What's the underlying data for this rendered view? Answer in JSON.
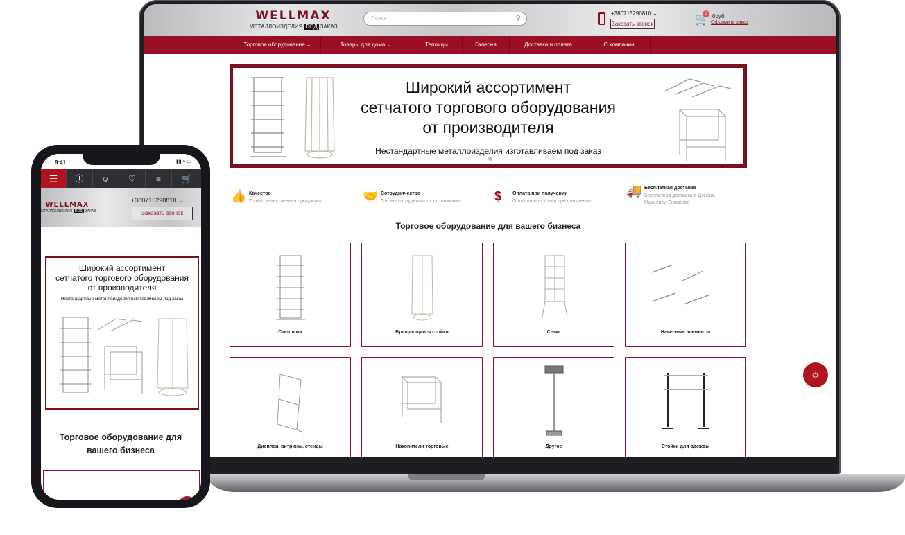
{
  "laptop": {
    "logo": {
      "main": "WELLMAX",
      "sub_left": "МЕТАЛЛОИЗДЕЛИЯ",
      "sub_box": "ПОД",
      "sub_right": "ЗАКАЗ"
    },
    "search": {
      "placeholder": "Поиск"
    },
    "header": {
      "phone": "+380715290810",
      "call_button": "Заказать звонок",
      "cart_count": "0",
      "cart_sum": "0руб.",
      "cart_order": "Оформить заказ"
    },
    "nav": [
      {
        "label": "Торговое оборудование",
        "has_caret": true
      },
      {
        "label": "Товары для дома",
        "has_caret": true
      },
      {
        "label": "Теплицы"
      },
      {
        "label": "Галерея"
      },
      {
        "label": "Доставка и оплата"
      },
      {
        "label": "О компании"
      }
    ],
    "banner": {
      "title_line1": "Широкий ассортимент",
      "title_line2": "сетчатого торгового оборудования",
      "title_line3": "от производителя",
      "subtitle": "Нестандартные металлоизделия изготавливаем под заказ"
    },
    "features": [
      {
        "icon": "thumbs-up-icon",
        "title": "Качество",
        "desc": "Только качественная продукция"
      },
      {
        "icon": "handshake-icon",
        "title": "Сотрудничество",
        "desc": "Готовы сотрудничать с оптовиками"
      },
      {
        "icon": "dollar-icon",
        "title": "Оплата при получении",
        "desc": "Оплачиваете товар при получении"
      },
      {
        "icon": "truck-icon",
        "title": "Бесплатная доставка",
        "desc": "Бесплатная доставка в Донецк, Макеевку, Енакиево"
      }
    ],
    "section_title": "Торговое оборудование для вашего бизнеса",
    "categories": [
      {
        "label": "Стеллажи",
        "icon": "shelf-rack-icon"
      },
      {
        "label": "Вращающиеся стойки",
        "icon": "rotating-stand-icon"
      },
      {
        "label": "Сетка",
        "icon": "mesh-panel-icon"
      },
      {
        "label": "Навесные элементы",
        "icon": "hooks-icon"
      },
      {
        "label": "Дисплеи, витрины, стенды",
        "icon": "display-stand-icon"
      },
      {
        "label": "Накопители торговые",
        "icon": "wire-basket-icon"
      },
      {
        "label": "Другое",
        "icon": "sign-holder-icon"
      },
      {
        "label": "Стойки для одежды",
        "icon": "clothes-rack-icon"
      }
    ],
    "colors": {
      "accent": "#9b0f25",
      "nav": "#9b0f25",
      "toolbar": "#2f2f33"
    }
  },
  "phone": {
    "time": "9:41",
    "header": {
      "phone": "+380715290810",
      "call_button": "Заказать звонок"
    },
    "banner": {
      "title_line1": "Широкий ассортимент",
      "title_line2": "сетчатого торгового оборудования",
      "title_line3": "от производителя",
      "subtitle": "Нестандартные металлоизделия изготавливаем под заказ"
    },
    "section_title_line1": "Торговое оборудование для",
    "section_title_line2": "вашего бизнеса"
  }
}
